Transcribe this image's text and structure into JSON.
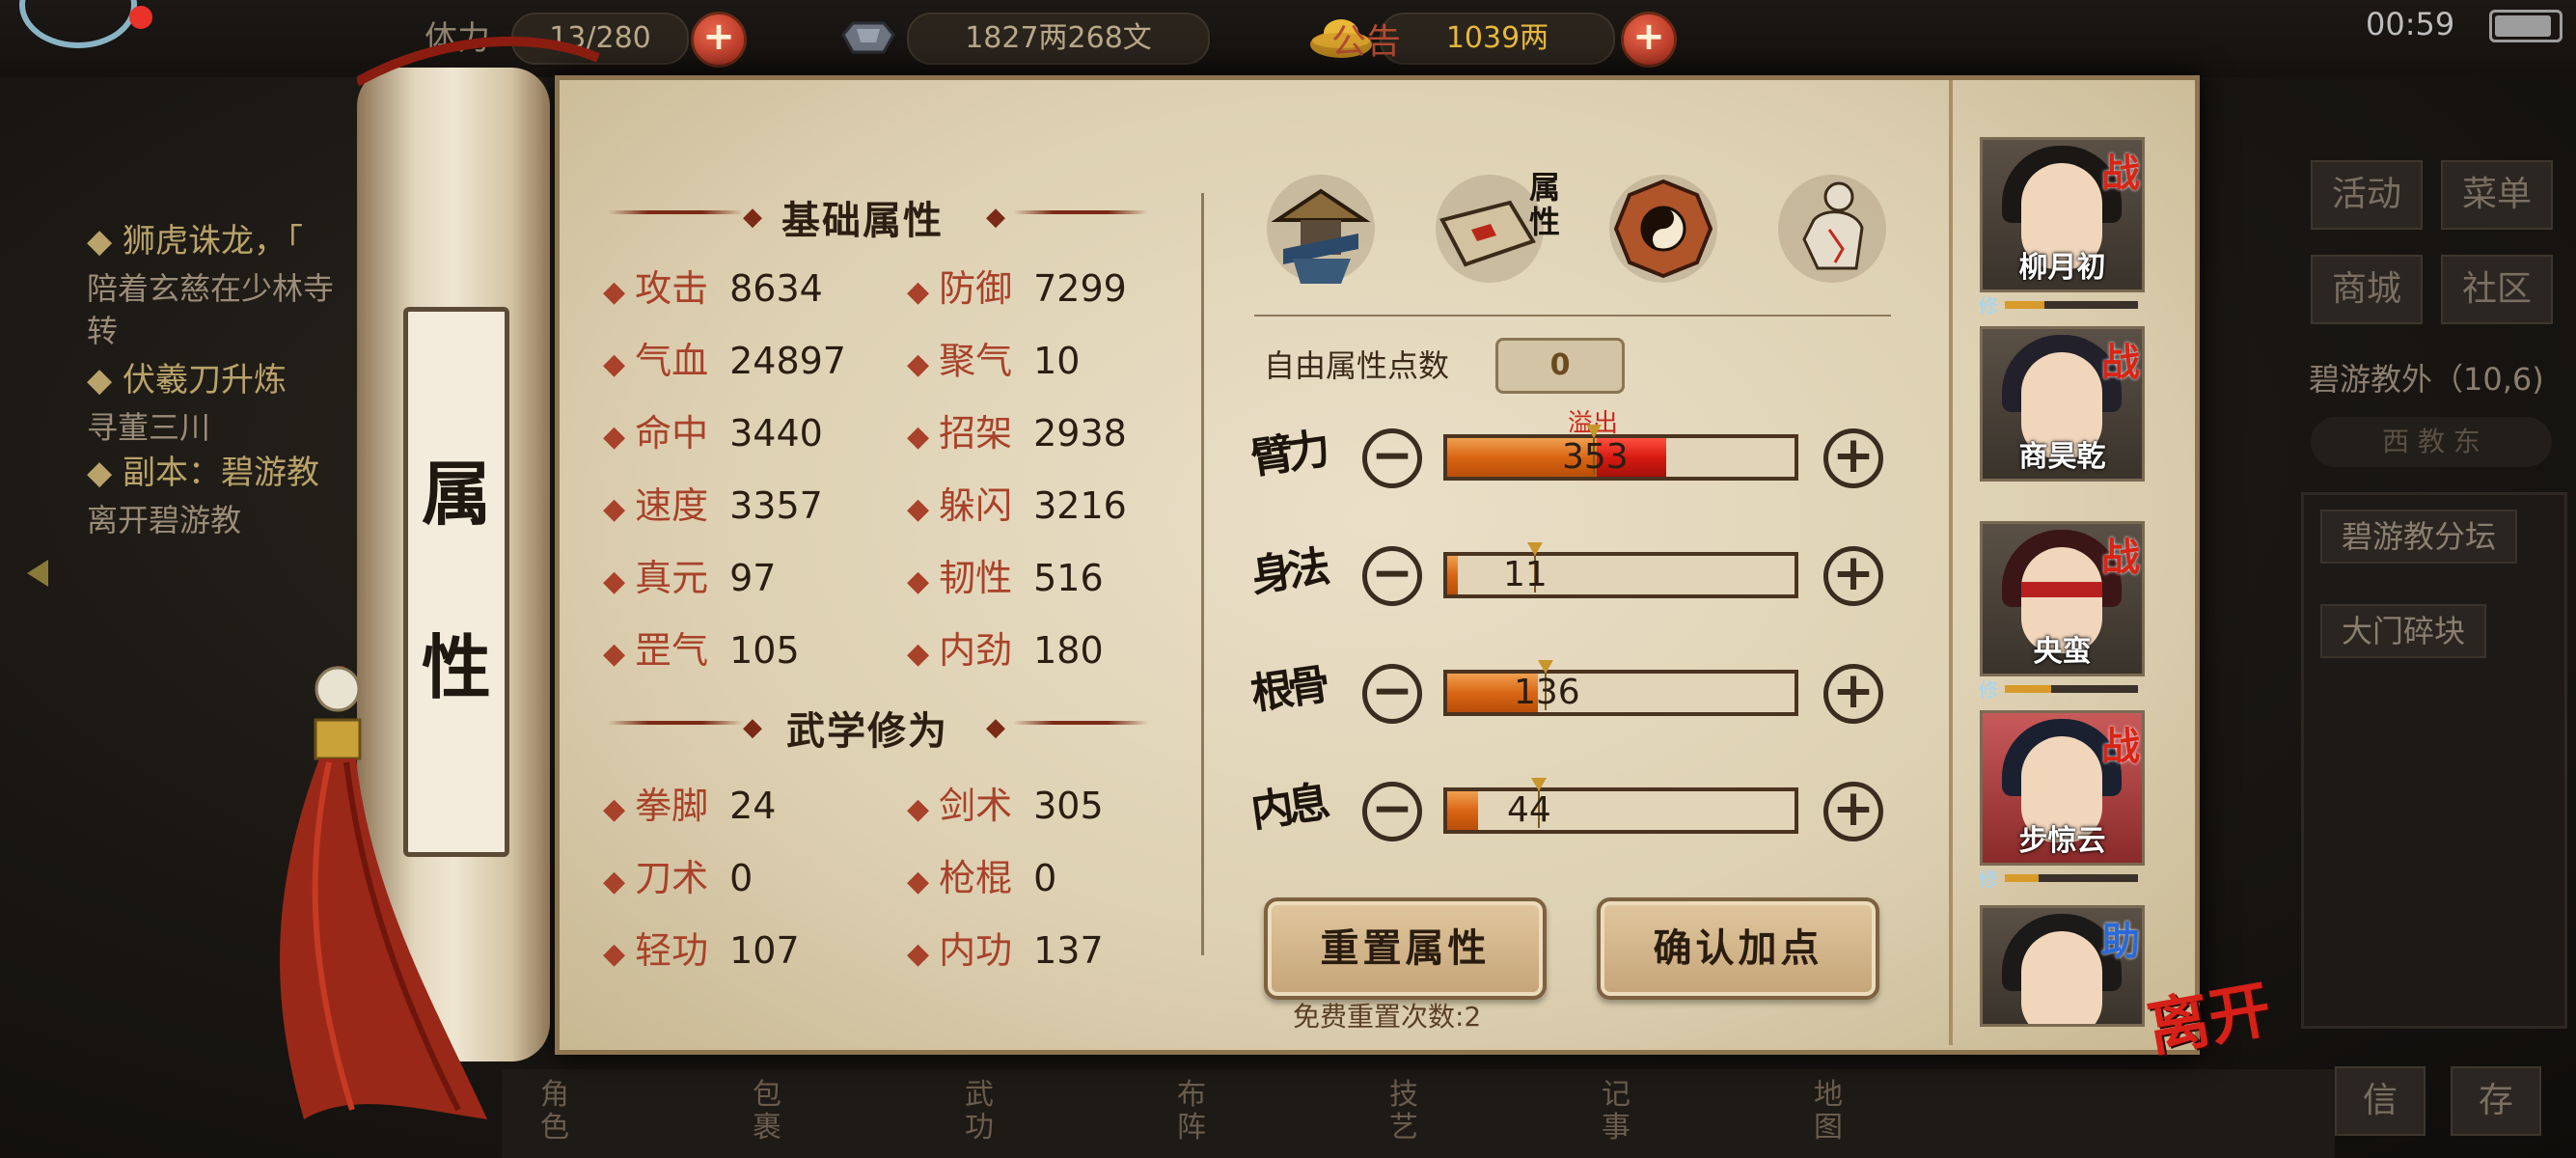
{
  "topbar": {
    "stamina": "13/280",
    "silver": "1827两268文",
    "gold": "1039两",
    "notice": "公告",
    "clock": "00:59"
  },
  "quests": [
    {
      "title": "◆ 狮虎诛龙，「",
      "desc": "陪着玄慈在少林寺",
      "desc2": "转"
    },
    {
      "title": "◆ 伏羲刀升炼",
      "desc": "寻董三川"
    },
    {
      "title": "◆ 副本：碧游教",
      "desc": "离开碧游教"
    }
  ],
  "right_side": {
    "buttons": [
      "活动",
      "菜单",
      "商城",
      "社区"
    ],
    "location": "碧游教外（10,6)",
    "nav_faded": "西 教 东",
    "targets": [
      "碧游教分坛",
      "大门碎块"
    ],
    "bottom": [
      "信",
      "存"
    ]
  },
  "panel": {
    "side_title": [
      "属",
      "性"
    ],
    "base_title": "基础属性",
    "martial_title": "武学修为",
    "base_stats": [
      {
        "label": "攻击",
        "value": "8634"
      },
      {
        "label": "防御",
        "value": "7299"
      },
      {
        "label": "气血",
        "value": "24897"
      },
      {
        "label": "聚气",
        "value": "10"
      },
      {
        "label": "命中",
        "value": "3440"
      },
      {
        "label": "招架",
        "value": "2938"
      },
      {
        "label": "速度",
        "value": "3357"
      },
      {
        "label": "躲闪",
        "value": "3216"
      },
      {
        "label": "真元",
        "value": "97"
      },
      {
        "label": "韧性",
        "value": "516"
      },
      {
        "label": "罡气",
        "value": "105"
      },
      {
        "label": "内劲",
        "value": "180"
      }
    ],
    "martial_stats": [
      {
        "label": "拳脚",
        "value": "24"
      },
      {
        "label": "剑术",
        "value": "305"
      },
      {
        "label": "刀术",
        "value": "0"
      },
      {
        "label": "枪棍",
        "value": "0"
      },
      {
        "label": "轻功",
        "value": "107"
      },
      {
        "label": "内功",
        "value": "137"
      }
    ],
    "tabs": [
      {
        "name": "character-tab",
        "label": ""
      },
      {
        "name": "attributes-tab",
        "label": "属性"
      },
      {
        "name": "bagua-tab",
        "label": ""
      },
      {
        "name": "meridian-tab",
        "label": ""
      }
    ],
    "free_points_label": "自由属性点数",
    "free_points": "0",
    "overflow_label": "溢出",
    "attributes": [
      {
        "label": "臂力",
        "value": "353",
        "fill": 0.43,
        "overflow": 0.2,
        "marker": 0.42
      },
      {
        "label": "身法",
        "value": "11",
        "fill": 0.03,
        "overflow": 0,
        "marker": 0.25
      },
      {
        "label": "根骨",
        "value": "136",
        "fill": 0.26,
        "overflow": 0,
        "marker": 0.28
      },
      {
        "label": "内息",
        "value": "44",
        "fill": 0.09,
        "overflow": 0,
        "marker": 0.26
      }
    ],
    "reset_button": "重置属性",
    "confirm_button": "确认加点",
    "reset_count": "免费重置次数:2",
    "leave": "离开"
  },
  "party": [
    {
      "name": "柳月初",
      "tag": "战",
      "xiu": "修",
      "progress": 0.3
    },
    {
      "name": "商昊乾",
      "tag": "战",
      "xiu": "",
      "progress": 0
    },
    {
      "name": "央蛮",
      "tag": "战",
      "xiu": "修",
      "progress": 0.35
    },
    {
      "name": "步惊云",
      "tag": "战",
      "xiu": "修",
      "progress": 0.25
    },
    {
      "name": "",
      "tag": "助",
      "xiu": "",
      "progress": 0
    }
  ],
  "bottom_nav": [
    "角色",
    "包裹",
    "武功",
    "布阵",
    "技艺",
    "记事",
    "地图"
  ]
}
